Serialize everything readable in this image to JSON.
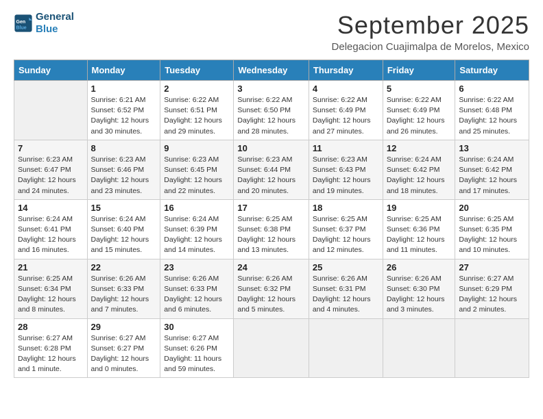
{
  "logo": {
    "line1": "General",
    "line2": "Blue"
  },
  "title": "September 2025",
  "subtitle": "Delegacion Cuajimalpa de Morelos, Mexico",
  "weekdays": [
    "Sunday",
    "Monday",
    "Tuesday",
    "Wednesday",
    "Thursday",
    "Friday",
    "Saturday"
  ],
  "weeks": [
    [
      {
        "day": "",
        "info": ""
      },
      {
        "day": "1",
        "info": "Sunrise: 6:21 AM\nSunset: 6:52 PM\nDaylight: 12 hours\nand 30 minutes."
      },
      {
        "day": "2",
        "info": "Sunrise: 6:22 AM\nSunset: 6:51 PM\nDaylight: 12 hours\nand 29 minutes."
      },
      {
        "day": "3",
        "info": "Sunrise: 6:22 AM\nSunset: 6:50 PM\nDaylight: 12 hours\nand 28 minutes."
      },
      {
        "day": "4",
        "info": "Sunrise: 6:22 AM\nSunset: 6:49 PM\nDaylight: 12 hours\nand 27 minutes."
      },
      {
        "day": "5",
        "info": "Sunrise: 6:22 AM\nSunset: 6:49 PM\nDaylight: 12 hours\nand 26 minutes."
      },
      {
        "day": "6",
        "info": "Sunrise: 6:22 AM\nSunset: 6:48 PM\nDaylight: 12 hours\nand 25 minutes."
      }
    ],
    [
      {
        "day": "7",
        "info": "Sunrise: 6:23 AM\nSunset: 6:47 PM\nDaylight: 12 hours\nand 24 minutes."
      },
      {
        "day": "8",
        "info": "Sunrise: 6:23 AM\nSunset: 6:46 PM\nDaylight: 12 hours\nand 23 minutes."
      },
      {
        "day": "9",
        "info": "Sunrise: 6:23 AM\nSunset: 6:45 PM\nDaylight: 12 hours\nand 22 minutes."
      },
      {
        "day": "10",
        "info": "Sunrise: 6:23 AM\nSunset: 6:44 PM\nDaylight: 12 hours\nand 20 minutes."
      },
      {
        "day": "11",
        "info": "Sunrise: 6:23 AM\nSunset: 6:43 PM\nDaylight: 12 hours\nand 19 minutes."
      },
      {
        "day": "12",
        "info": "Sunrise: 6:24 AM\nSunset: 6:42 PM\nDaylight: 12 hours\nand 18 minutes."
      },
      {
        "day": "13",
        "info": "Sunrise: 6:24 AM\nSunset: 6:42 PM\nDaylight: 12 hours\nand 17 minutes."
      }
    ],
    [
      {
        "day": "14",
        "info": "Sunrise: 6:24 AM\nSunset: 6:41 PM\nDaylight: 12 hours\nand 16 minutes."
      },
      {
        "day": "15",
        "info": "Sunrise: 6:24 AM\nSunset: 6:40 PM\nDaylight: 12 hours\nand 15 minutes."
      },
      {
        "day": "16",
        "info": "Sunrise: 6:24 AM\nSunset: 6:39 PM\nDaylight: 12 hours\nand 14 minutes."
      },
      {
        "day": "17",
        "info": "Sunrise: 6:25 AM\nSunset: 6:38 PM\nDaylight: 12 hours\nand 13 minutes."
      },
      {
        "day": "18",
        "info": "Sunrise: 6:25 AM\nSunset: 6:37 PM\nDaylight: 12 hours\nand 12 minutes."
      },
      {
        "day": "19",
        "info": "Sunrise: 6:25 AM\nSunset: 6:36 PM\nDaylight: 12 hours\nand 11 minutes."
      },
      {
        "day": "20",
        "info": "Sunrise: 6:25 AM\nSunset: 6:35 PM\nDaylight: 12 hours\nand 10 minutes."
      }
    ],
    [
      {
        "day": "21",
        "info": "Sunrise: 6:25 AM\nSunset: 6:34 PM\nDaylight: 12 hours\nand 8 minutes."
      },
      {
        "day": "22",
        "info": "Sunrise: 6:26 AM\nSunset: 6:33 PM\nDaylight: 12 hours\nand 7 minutes."
      },
      {
        "day": "23",
        "info": "Sunrise: 6:26 AM\nSunset: 6:33 PM\nDaylight: 12 hours\nand 6 minutes."
      },
      {
        "day": "24",
        "info": "Sunrise: 6:26 AM\nSunset: 6:32 PM\nDaylight: 12 hours\nand 5 minutes."
      },
      {
        "day": "25",
        "info": "Sunrise: 6:26 AM\nSunset: 6:31 PM\nDaylight: 12 hours\nand 4 minutes."
      },
      {
        "day": "26",
        "info": "Sunrise: 6:26 AM\nSunset: 6:30 PM\nDaylight: 12 hours\nand 3 minutes."
      },
      {
        "day": "27",
        "info": "Sunrise: 6:27 AM\nSunset: 6:29 PM\nDaylight: 12 hours\nand 2 minutes."
      }
    ],
    [
      {
        "day": "28",
        "info": "Sunrise: 6:27 AM\nSunset: 6:28 PM\nDaylight: 12 hours\nand 1 minute."
      },
      {
        "day": "29",
        "info": "Sunrise: 6:27 AM\nSunset: 6:27 PM\nDaylight: 12 hours\nand 0 minutes."
      },
      {
        "day": "30",
        "info": "Sunrise: 6:27 AM\nSunset: 6:26 PM\nDaylight: 11 hours\nand 59 minutes."
      },
      {
        "day": "",
        "info": ""
      },
      {
        "day": "",
        "info": ""
      },
      {
        "day": "",
        "info": ""
      },
      {
        "day": "",
        "info": ""
      }
    ]
  ]
}
